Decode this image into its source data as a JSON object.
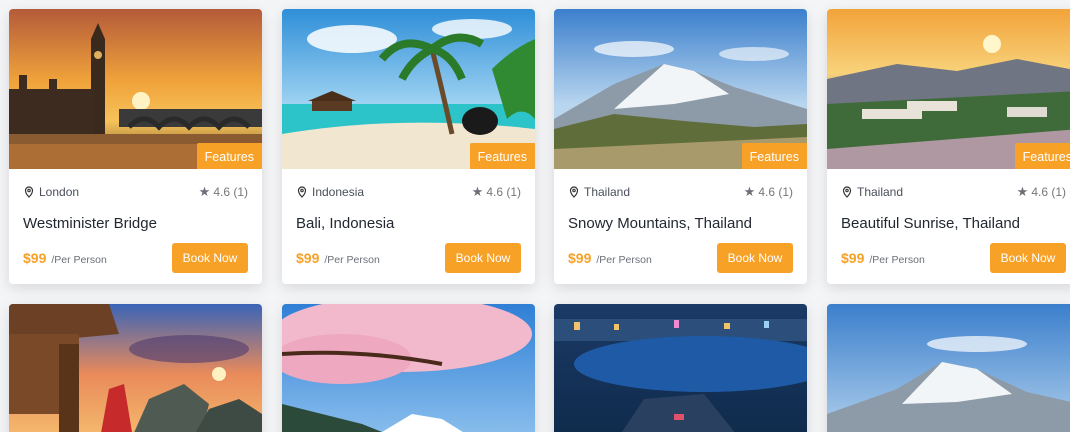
{
  "cards": [
    {
      "badge": "Features",
      "location": "London",
      "rating": "4.6 (1)",
      "title": "Westminister Bridge",
      "price": "$99",
      "per": "/Per Person",
      "button": "Book Now"
    },
    {
      "badge": "Features",
      "location": "Indonesia",
      "rating": "4.6 (1)",
      "title": "Bali, Indonesia",
      "price": "$99",
      "per": "/Per Person",
      "button": "Book Now"
    },
    {
      "badge": "Features",
      "location": "Thailand",
      "rating": "4.6 (1)",
      "title": "Snowy Mountains, Thailand",
      "price": "$99",
      "per": "/Per Person",
      "button": "Book Now"
    },
    {
      "badge": "Features",
      "location": "Thailand",
      "rating": "4.6 (1)",
      "title": "Beautiful Sunrise, Thailand",
      "price": "$99",
      "per": "/Per Person",
      "button": "Book Now"
    }
  ],
  "colors": {
    "accent": "#f7a127",
    "text": "#222731",
    "muted": "#6b6f77"
  },
  "icons": {
    "location": "map-pin-icon",
    "rating": "star-icon"
  }
}
